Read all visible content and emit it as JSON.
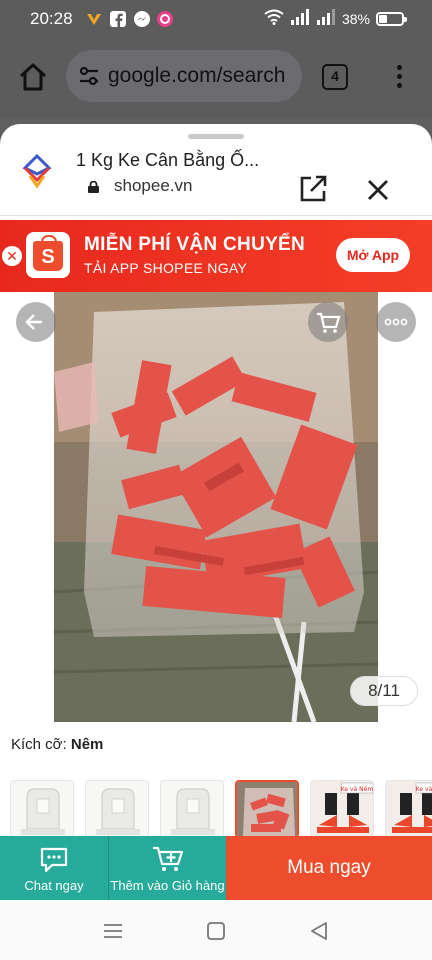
{
  "status_bar": {
    "time": "20:28",
    "battery_percent": "38%",
    "battery_level": 0.38,
    "notifications": [
      "vpn-icon",
      "facebook-icon",
      "messenger-icon",
      "app-icon"
    ]
  },
  "browser": {
    "url": "google.com/search",
    "tab_count": "4"
  },
  "sheet": {
    "title": "1 Kg Ke Cân Bằng Ố...",
    "domain": "shopee.vn"
  },
  "banner": {
    "title": "MIỄN PHÍ VẬN CHUYỂN",
    "subtitle": "TẢI APP SHOPEE NGAY",
    "logo_letter": "S",
    "open_app": "Mở App"
  },
  "gallery": {
    "counter": "8/11"
  },
  "variant": {
    "label": "Kích cỡ: ",
    "value": "Nêm"
  },
  "thumbnails": [
    {
      "kind": "clear-clip"
    },
    {
      "kind": "clear-clip"
    },
    {
      "kind": "clear-clip"
    },
    {
      "kind": "red-wedge-bag",
      "selected": true
    },
    {
      "kind": "black-red-clip",
      "tag": "Ke và Nêm"
    },
    {
      "kind": "black-red-clip",
      "tag": "Ke và Nêm"
    }
  ],
  "actions": {
    "chat": "Chat ngay",
    "cart": "Thêm vào Giỏ hàng",
    "buy": "Mua ngay"
  },
  "colors": {
    "shopee_orange": "#ee4d2d",
    "teal": "#26aa99",
    "banner_red": "#e8281d"
  }
}
